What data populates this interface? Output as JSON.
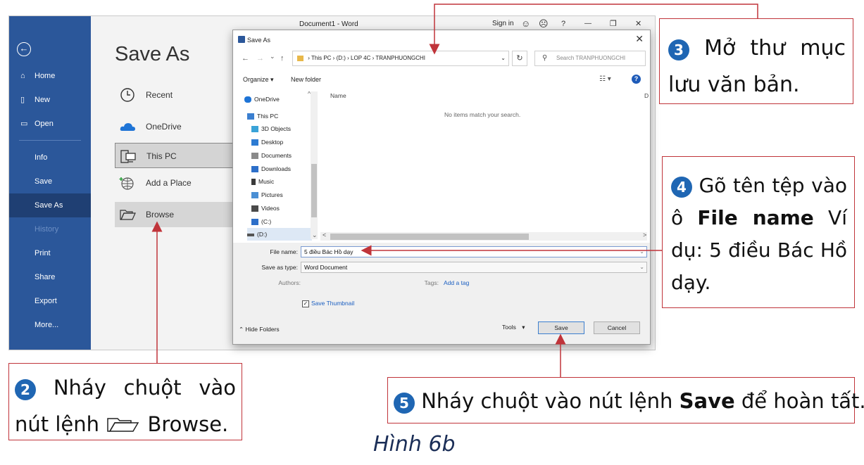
{
  "word": {
    "title": "Document1 - Word",
    "signin": "Sign in",
    "titlebar_icons": [
      "smiley-icon",
      "frown-icon",
      "help-icon",
      "minimize-icon",
      "restore-icon",
      "close-icon"
    ],
    "titlebar_glyphs": [
      "☺",
      "☹",
      "?",
      "—",
      "❐",
      "✕"
    ],
    "sidebar": {
      "back_glyph": "←",
      "items": [
        {
          "label": "Home",
          "icon": "home-icon",
          "glyph": "⌂"
        },
        {
          "label": "New",
          "icon": "new-document-icon",
          "glyph": "▯"
        },
        {
          "label": "Open",
          "icon": "open-folder-icon",
          "glyph": "▭"
        },
        {
          "label": "Info",
          "icon": "",
          "glyph": ""
        },
        {
          "label": "Save",
          "icon": "",
          "glyph": ""
        },
        {
          "label": "Save As",
          "icon": "",
          "glyph": ""
        },
        {
          "label": "History",
          "icon": "",
          "glyph": ""
        },
        {
          "label": "Print",
          "icon": "",
          "glyph": ""
        },
        {
          "label": "Share",
          "icon": "",
          "glyph": ""
        },
        {
          "label": "Export",
          "icon": "",
          "glyph": ""
        },
        {
          "label": "More...",
          "icon": "",
          "glyph": ""
        }
      ]
    },
    "backstage": {
      "heading": "Save As",
      "locations": [
        {
          "label": "Recent",
          "icon": "clock-icon"
        },
        {
          "label": "OneDrive",
          "icon": "cloud-icon"
        },
        {
          "label": "This PC",
          "icon": "pc-icon"
        },
        {
          "label": "Add a Place",
          "icon": "globe-plus-icon"
        },
        {
          "label": "Browse",
          "icon": "folder-open-icon"
        }
      ]
    }
  },
  "dialog": {
    "title": "Save As",
    "close_glyph": "✕",
    "nav_glyphs": [
      "←",
      "→",
      "⌄",
      "↑"
    ],
    "address": {
      "segments": [
        "This PC",
        "(D:)",
        "LOP 4C",
        "TRANPHUONGCHI"
      ],
      "separator": "›",
      "dropdown_glyph": "⌄"
    },
    "refresh_glyph": "↻",
    "search_placeholder": "Search TRANPHUONGCHI",
    "search_glyph": "⚲",
    "organize": "Organize ▾",
    "new_folder": "New folder",
    "view_glyph": "☷ ▾",
    "help_glyph": "?",
    "nav_pane": [
      {
        "label": "OneDrive",
        "icon": "cloud-icon",
        "color": "#1e74d6",
        "glyph": "^"
      },
      {
        "label": "This PC",
        "icon": "pc-icon",
        "color": "#3b7fd0"
      },
      {
        "label": "3D Objects",
        "icon": "cube-icon",
        "color": "#3aa3d8"
      },
      {
        "label": "Desktop",
        "icon": "desktop-icon",
        "color": "#2d7bd2"
      },
      {
        "label": "Documents",
        "icon": "documents-icon",
        "color": "#8a8a8a"
      },
      {
        "label": "Downloads",
        "icon": "download-icon",
        "color": "#2d6fc9"
      },
      {
        "label": "Music",
        "icon": "music-icon",
        "color": "#3a3a3a"
      },
      {
        "label": "Pictures",
        "icon": "pictures-icon",
        "color": "#4a8fd4"
      },
      {
        "label": "Videos",
        "icon": "videos-icon",
        "color": "#4a4a4a"
      },
      {
        "label": "(C:)",
        "icon": "drive-c-icon",
        "color": "#2d6fc9"
      },
      {
        "label": "(D:)",
        "icon": "drive-d-icon",
        "color": "#555555"
      }
    ],
    "file_column_name": "Name",
    "file_column_d": "D",
    "empty_message": "No items match your search.",
    "scroll_glyphs": [
      "⌄",
      "<",
      ">"
    ],
    "file_name_label": "File name:",
    "file_name_value": "5 điều Bác Hồ dạy",
    "save_as_type_label": "Save as type:",
    "save_as_type_value": "Word Document",
    "type_dropdown_glyph": "⌄",
    "authors_label": "Authors:",
    "tags_label": "Tags:",
    "tags_link": "Add a tag",
    "thumbnail_label": "Save Thumbnail",
    "thumbnail_checked": true,
    "check_glyph": "✓",
    "hide_folders": "Hide Folders",
    "hide_glyph": "⌃",
    "tools": "Tools",
    "tools_glyph": "▾",
    "save_button": "Save",
    "cancel_button": "Cancel"
  },
  "callouts": {
    "step2": {
      "number": "2",
      "text_a": "Nháy chuột vào nút lệnh",
      "text_b": "Browse."
    },
    "step3": {
      "number": "3",
      "text": "Mở thư mục lưu văn bản."
    },
    "step4": {
      "number": "4",
      "text_a": "Gõ tên tệp vào ô",
      "bold": "File name",
      "text_b": "Ví dụ: 5 điều Bác Hồ dạy."
    },
    "step5": {
      "number": "5",
      "text_a": "Nháy chuột vào nút lệnh",
      "bold": "Save",
      "text_b": "để hoàn tất."
    }
  },
  "caption": "Hình 6b",
  "colors": {
    "word_blue": "#2b579a",
    "callout_border": "#c0343a",
    "badge_blue": "#1f66b3",
    "caption_navy": "#1b2e57"
  }
}
